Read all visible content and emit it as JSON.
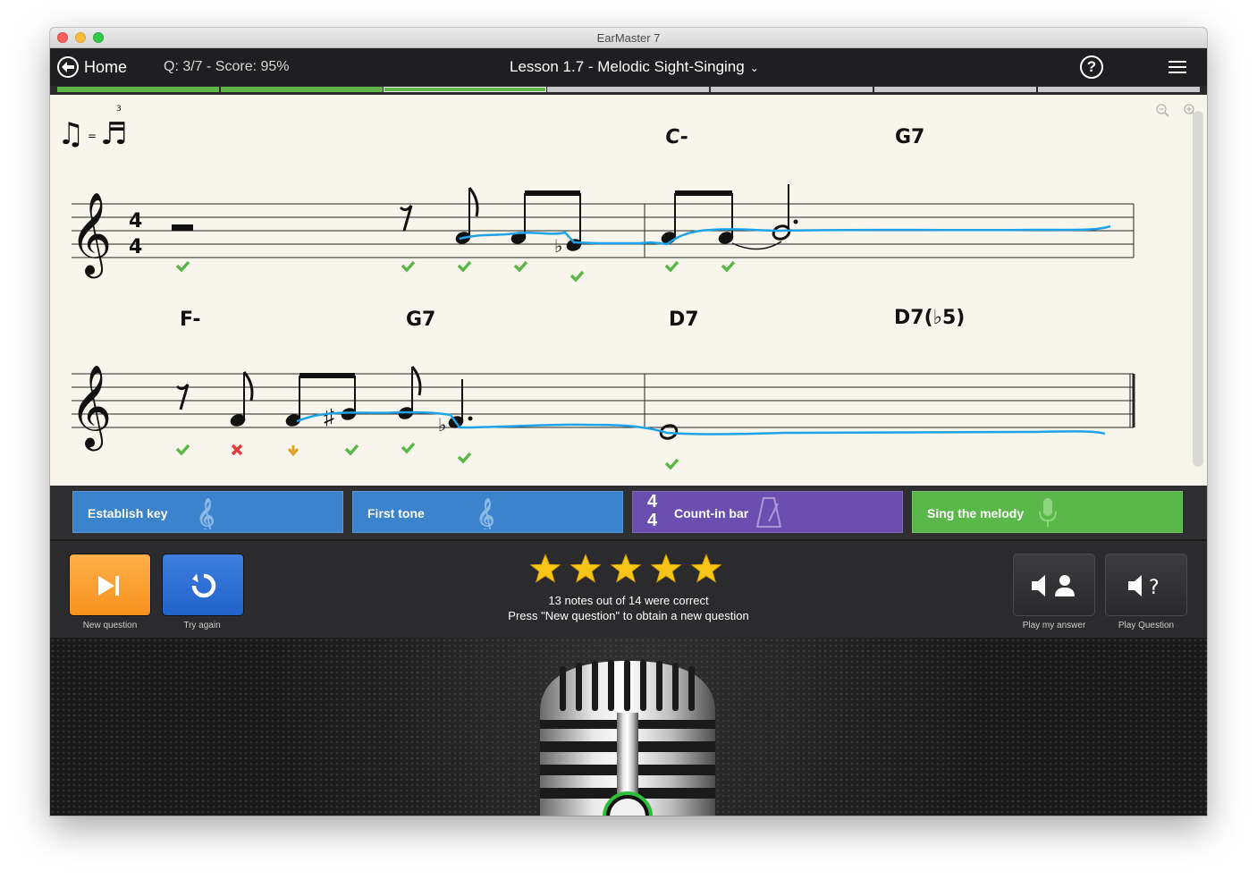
{
  "window": {
    "title": "EarMaster 7"
  },
  "navbar": {
    "home_label": "Home",
    "q_score": "Q: 3/7 - Score: 95%",
    "lesson_title": "Lesson 1.7 - Melodic Sight-Singing",
    "progress": {
      "total_segments": 7,
      "completed": 2,
      "current_index": 3
    }
  },
  "score": {
    "swing_hint": "♫ = ♪♬",
    "time_signature": {
      "top": "4",
      "bottom": "4"
    },
    "row1_chords": [
      "C-",
      "G7"
    ],
    "row2_chords": [
      "F-",
      "G7",
      "D7",
      "D7(♭5)"
    ],
    "feedback_colors": {
      "correct": "#5cb749",
      "wrong": "#e23b3b",
      "adjust": "#e0a22a",
      "pitch_line": "#1fa3e8"
    }
  },
  "steps": [
    {
      "label": "Establish key",
      "icon": "treble-clef-icon"
    },
    {
      "label": "First tone",
      "icon": "treble-clef-icon"
    },
    {
      "label": "Count-in bar",
      "icon": "metronome-icon",
      "time_sig_top": "4",
      "time_sig_bottom": "4"
    },
    {
      "label": "Sing the melody",
      "icon": "microphone-icon"
    }
  ],
  "controls": {
    "new_question_label": "New question",
    "try_again_label": "Try again",
    "play_my_answer_label": "Play my answer",
    "play_question_label": "Play Question",
    "stars_earned": 5,
    "stars_total": 5,
    "result_line": "13 notes out of 14 were correct",
    "instruction_line": "Press \"New question\" to obtain a new question"
  },
  "colors": {
    "navbar": "#1f1f21",
    "progress_done": "#5fb648",
    "step_blue": "#3b83cc",
    "step_purple": "#6a4fb0",
    "step_green": "#5ab84a",
    "star": "#f5c518",
    "orange_button": "#f7921e",
    "blue_button": "#2163c9"
  }
}
